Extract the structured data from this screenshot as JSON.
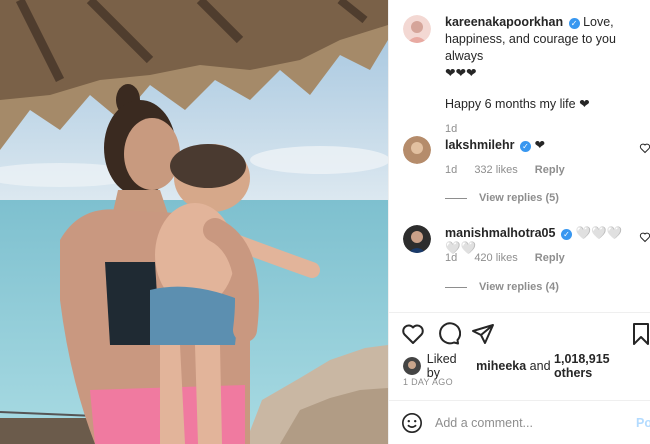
{
  "post": {
    "author": "kareenakapoorkhan",
    "caption_text": "Love, happiness, and courage to you always",
    "caption_hearts": "❤❤❤",
    "caption_line2": "Happy 6 months my life ❤",
    "time": "1d"
  },
  "comments": [
    {
      "user": "lakshmilehr",
      "text": "❤",
      "time": "1d",
      "likes": "332 likes",
      "reply": "Reply",
      "view_replies": "View replies (5)"
    },
    {
      "user": "manishmalhotra05",
      "text": "🤍🤍🤍🤍🤍",
      "time": "1d",
      "likes": "420 likes",
      "reply": "Reply",
      "view_replies": "View replies (4)"
    }
  ],
  "likes": {
    "prefix": "Liked by",
    "user": "miheeka",
    "joiner": "and",
    "others": "1,018,915 others"
  },
  "timestamp": "1 DAY AGO",
  "add_comment": {
    "placeholder": "Add a comment...",
    "post_label": "Po"
  },
  "colors": {
    "verified": "#3897f0",
    "secondary": "#8e8e8e",
    "post_button": "#b3dbff"
  },
  "icons": [
    "heart-icon",
    "comment-icon",
    "share-icon",
    "bookmark-icon",
    "smile-icon",
    "verified-icon"
  ]
}
